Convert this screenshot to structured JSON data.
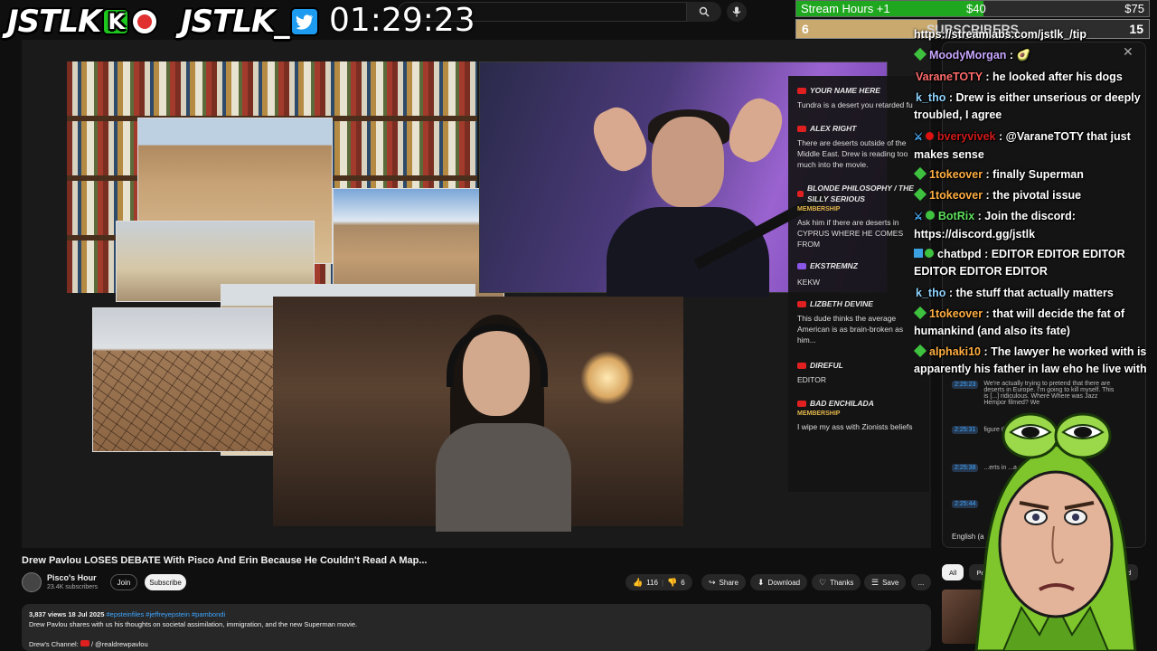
{
  "overlay": {
    "brand_left": "JSTLK",
    "brand_left_badge": "K",
    "brand_right": "JSTLK_",
    "timer": "01:29:23",
    "goal_hours": {
      "label": "Stream Hours +1",
      "current": "$40",
      "target": "$75",
      "progress": 0.53
    },
    "goal_subs": {
      "label": "SUBSCRIBERS",
      "current": "6",
      "target": "15",
      "progress": 0.4
    },
    "tip_url": "https://streamlabs.com/jstlk_/tip",
    "chat": [
      {
        "user": "MoodyMorgan",
        "color": "#c8a6ff",
        "text": " : 🥑",
        "icon": "diamond"
      },
      {
        "user": "VaraneTOTY",
        "color": "#ff6b6b",
        "text": " : he looked after his dogs",
        "icon": ""
      },
      {
        "user": "k_tho",
        "color": "#8fd3ff",
        "text": " : Drew is either unserious or deeply troubled, I agree",
        "icon": ""
      },
      {
        "user": "bveryvivek",
        "color": "#d11a1a",
        "text": " : @VaraneTOTY that just makes sense",
        "icon": "sword-red"
      },
      {
        "user": "1tokeover",
        "color": "#ffae42",
        "text": " : finally Superman",
        "icon": "diamond"
      },
      {
        "user": "1tokeover",
        "color": "#ffae42",
        "text": " : the pivotal issue",
        "icon": "diamond"
      },
      {
        "user": "BotRix",
        "color": "#5ee05e",
        "text": " : Join the discord: https://discord.gg/jstlk",
        "icon": "sword-check"
      },
      {
        "user": "chatbpd",
        "color": "#ffffff",
        "text": " : EDITOR EDITOR EDITOR EDITOR EDITOR EDITOR",
        "icon": "cube"
      },
      {
        "user": "k_tho",
        "color": "#8fd3ff",
        "text": " : the stuff that actually matters",
        "icon": ""
      },
      {
        "user": "1tokeover",
        "color": "#ffae42",
        "text": " : that will decide the fat of humankind (and also its fate)",
        "icon": "diamond"
      },
      {
        "user": "alphaki10",
        "color": "#ffae42",
        "text": " : The lawyer he worked with is apparently his father in law eho he live with",
        "icon": "diamond"
      }
    ]
  },
  "video": {
    "embedded_chat": [
      {
        "name": "YOUR NAME HERE",
        "badge": "",
        "text": "Tundra is a desert you retarded fu"
      },
      {
        "name": "ALEX RIGHT",
        "badge": "",
        "text": "There are deserts outside of the Middle East. Drew is reading too much into the movie."
      },
      {
        "name": "BLONDE PHILOSOPHY / THE SILLY SERIOUS",
        "badge": "MEMBERSHIP",
        "text": "Ask him if there are deserts in CYPRUS WHERE HE COMES FROM"
      },
      {
        "name": "EKSTREMNZ",
        "badge": "",
        "text": "KEKW"
      },
      {
        "name": "LIZBETH DEVINE",
        "badge": "",
        "text": "This dude thinks the average American is as brain-broken as him..."
      },
      {
        "name": "DIREFUL",
        "badge": "",
        "text": "EDITOR"
      },
      {
        "name": "BAD ENCHILADA",
        "badge": "MEMBERSHIP",
        "text": "I wipe my ass with Zionists beliefs"
      }
    ]
  },
  "yt": {
    "title": "Drew Pavlou LOSES DEBATE With Pisco And Erin Because He Couldn't Read A Map...",
    "channel": "Pisco's Hour",
    "subs": "23.4K subscribers",
    "join": "Join",
    "subscribe": "Subscribe",
    "likes": "116",
    "dislikes": "6",
    "share": "Share",
    "download": "Download",
    "thanks": "Thanks",
    "save": "Save",
    "more": "...",
    "views_date": "3,837 views  18 Jul 2025",
    "hashtags": "#epsteinfiles #jeffreyepstein #pambondi",
    "description": "Drew Pavlou shares with us his thoughts on societal assimilation, immigration, and the new Superman movie.",
    "drews_channel_label": "Drew's Channel:",
    "drews_channel_handle": "/ @realdrewpavlou",
    "transcript": [
      {
        "time": "2:25:23",
        "text": "We're actually trying to pretend that there are deserts in Europe. I'm going to kill myself. This is [...] ridiculous. Where Where was Jazz Hempor filmed? We"
      },
      {
        "time": "2:25:31",
        "text": "figure this out. ...ly at the"
      },
      {
        "time": "2:25:38",
        "text": "...erts in ...a"
      },
      {
        "time": "2:25:44",
        "text": ""
      }
    ],
    "transcript_lang": "English (a",
    "chips": [
      "All",
      "Politics n",
      "...loaded"
    ]
  }
}
